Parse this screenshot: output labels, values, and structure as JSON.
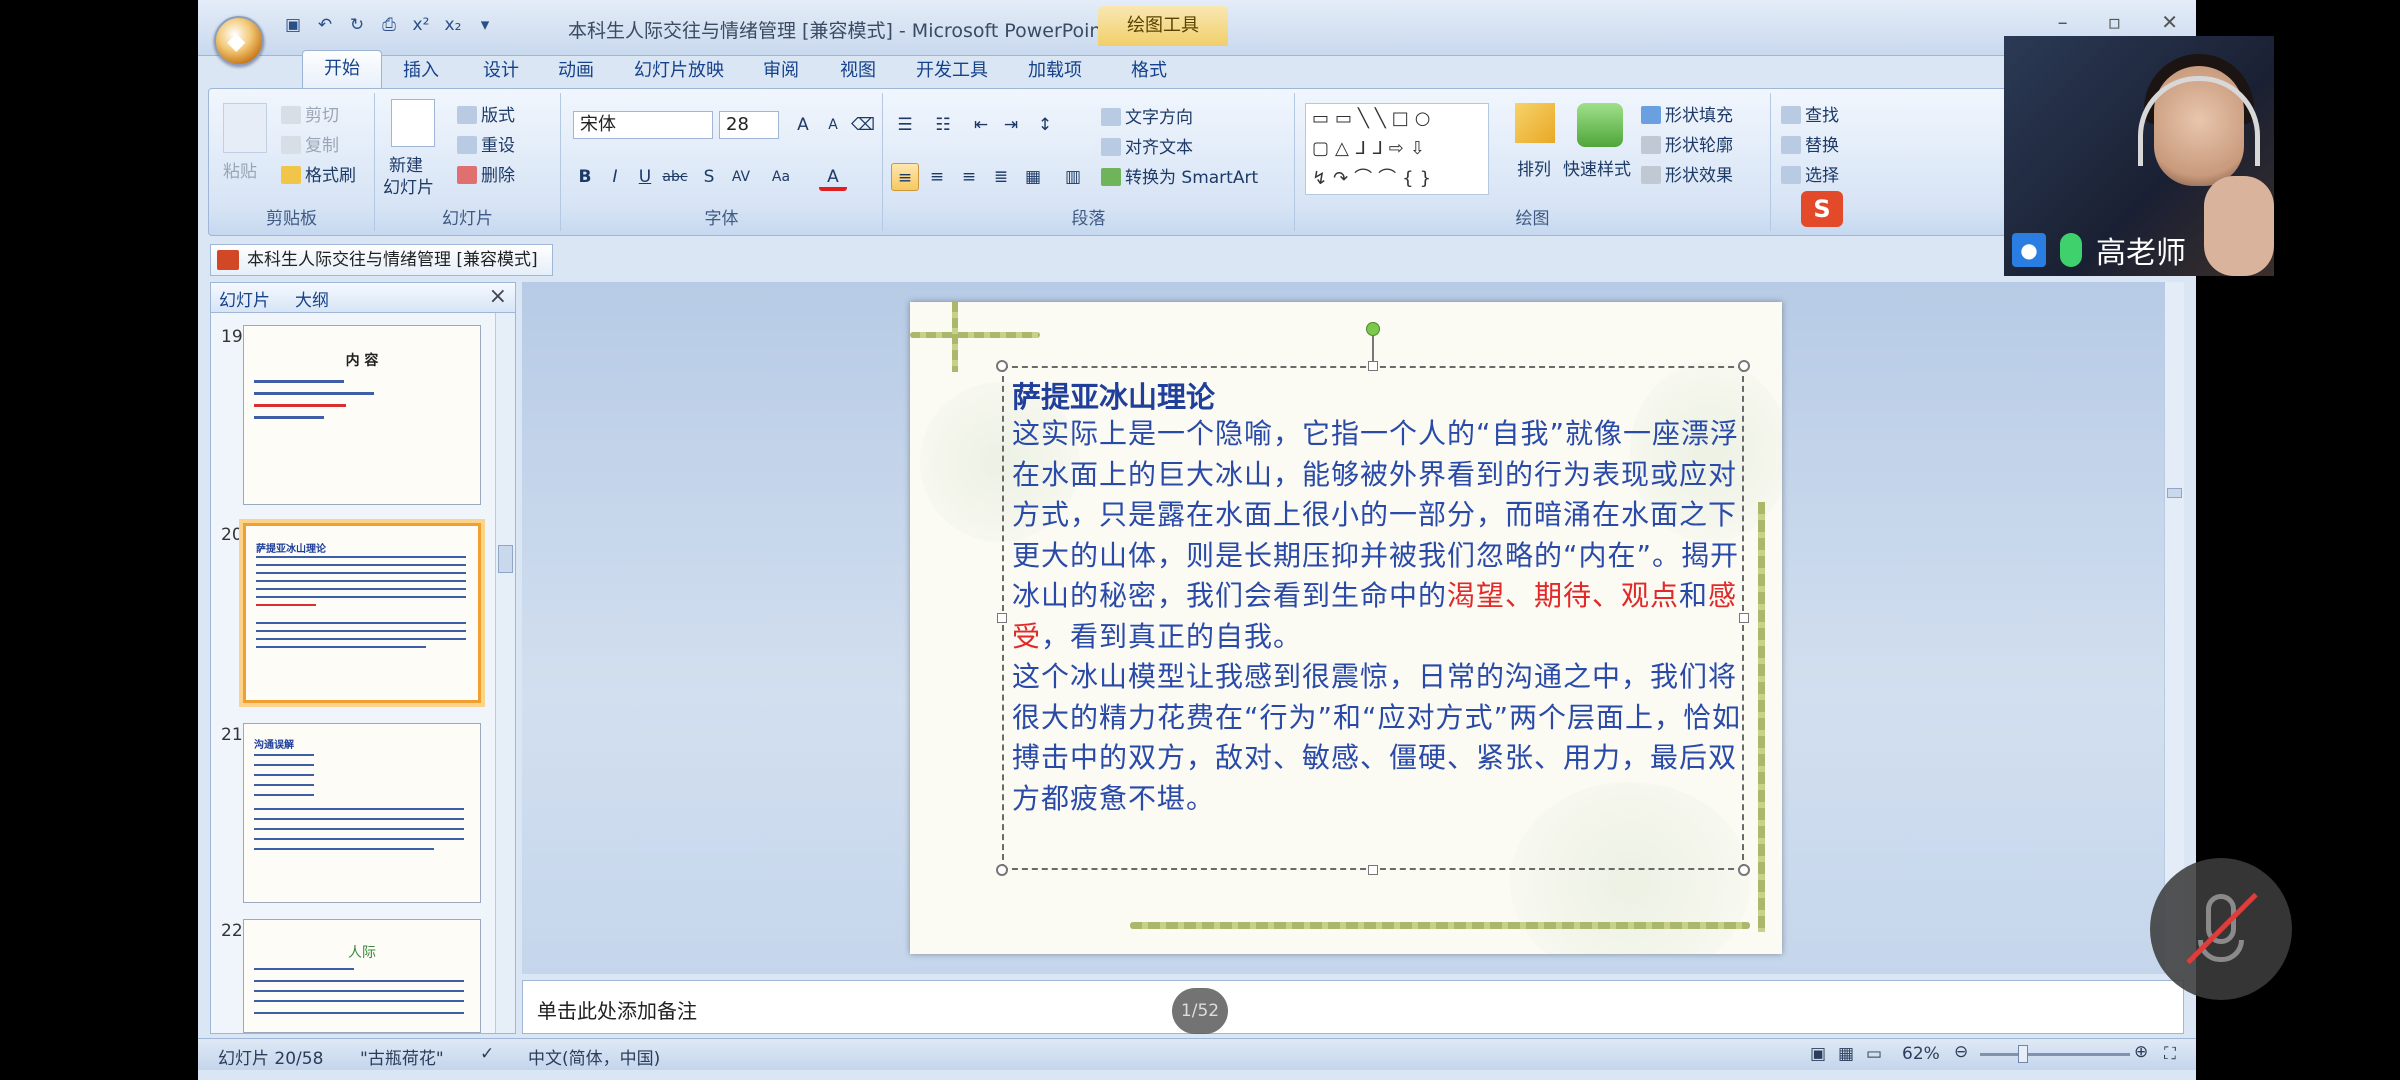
{
  "app": {
    "title": "本科生人际交往与情绪管理 [兼容模式] - Microsoft PowerPoint",
    "context_tab": "绘图工具"
  },
  "ribbon_tabs": [
    "开始",
    "插入",
    "设计",
    "动画",
    "幻灯片放映",
    "审阅",
    "视图",
    "开发工具",
    "加载项",
    "格式"
  ],
  "ribbon": {
    "clipboard": {
      "paste": "粘贴",
      "cut": "剪切",
      "copy": "复制",
      "format_painter": "格式刷",
      "label": "剪贴板"
    },
    "slides": {
      "new_slide": "新建",
      "new_slide2": "幻灯片",
      "layout": "版式",
      "reset": "重设",
      "delete": "删除",
      "label": "幻灯片"
    },
    "font": {
      "name": "宋体",
      "size": "28",
      "label": "字体"
    },
    "paragraph": {
      "text_direction": "文字方向",
      "align_text": "对齐文本",
      "smartart": "转换为 SmartArt",
      "label": "段落"
    },
    "drawing": {
      "arrange": "排列",
      "quick_styles": "快速样式",
      "shape_fill": "形状填充",
      "shape_outline": "形状轮廓",
      "shape_effects": "形状效果",
      "label": "绘图"
    },
    "editing": {
      "find": "查找",
      "replace": "替换",
      "select": "选择"
    }
  },
  "doc_tab": "本科生人际交往与情绪管理 [兼容模式]",
  "left_panel": {
    "tab_slides": "幻灯片",
    "tab_outline": "大纲",
    "slides": [
      {
        "num": "19",
        "title": "内 容"
      },
      {
        "num": "20",
        "title": "萨提亚冰山理论"
      },
      {
        "num": "21",
        "title": "沟通误解"
      },
      {
        "num": "22",
        "title": "人际"
      }
    ]
  },
  "slide": {
    "title": "萨提亚冰山理论",
    "p1_a": "这实际上是一个隐喻，它指一个人的“自我”就像一座漂浮在水面上的巨大冰山，能够被外界看到的行为表现或应对方式，只是露在水面上很小的一部分，而暗涌在水面之下更大的山体，则是长期压抑并被我们忽略的“内在”。揭开冰山的秘密，我们会看到生命中的",
    "p1_red": "渴望、期待、观点",
    "p1_and": "和",
    "p1_red2": "感受",
    "p1_end": "，看到真正的自我。",
    "p2": "这个冰山模型让我感到很震惊，日常的沟通之中，我们将很大的精力花费在“行为”和“应对方式”两个层面上，恰如搏击中的双方，敌对、敏感、僵硬、紧张、用力，最后双方都疲惫不堪。"
  },
  "notes_placeholder": "单击此处添加备注",
  "status": {
    "slide_counter": "幻灯片 20/58",
    "theme": "\"古瓶荷花\"",
    "language": "中文(简体，中国)",
    "zoom": "62%"
  },
  "page_badge": "1/52",
  "webcam": {
    "name": "高老师"
  },
  "colors": {
    "accent": "#15428b",
    "slide_text": "#2a4aa8",
    "highlight": "#e02a2a"
  }
}
